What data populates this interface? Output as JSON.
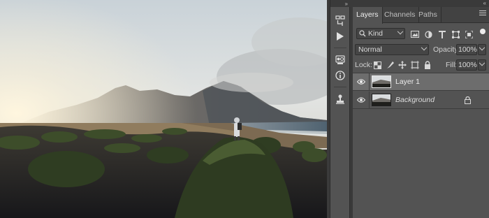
{
  "canvas": {
    "subject": "photo-canvas"
  },
  "dock": {
    "collapse_glyph": "»",
    "tools": [
      "history-icon",
      "play-actions-icon",
      "color-swatch-icon",
      "info-icon",
      "stamp-icon"
    ]
  },
  "layers_panel": {
    "collapse_glyph": "«",
    "tabs": [
      {
        "label": "Layers",
        "active": true
      },
      {
        "label": "Channels",
        "active": false
      },
      {
        "label": "Paths",
        "active": false
      }
    ],
    "filter": {
      "kind_label": "Kind"
    },
    "blend_mode": "Normal",
    "opacity_label": "Opacity:",
    "opacity_value": "100%",
    "lock_label": "Lock:",
    "fill_label": "Fill:",
    "fill_value": "100%",
    "layers": [
      {
        "name": "Layer 1",
        "selected": true,
        "visible": true,
        "locked": false
      },
      {
        "name": "Background",
        "selected": false,
        "visible": true,
        "locked": true
      }
    ]
  },
  "colors": {
    "panel_bg": "#535353",
    "tab_bar_bg": "#424242",
    "selected_row": "#6d6d6d"
  }
}
